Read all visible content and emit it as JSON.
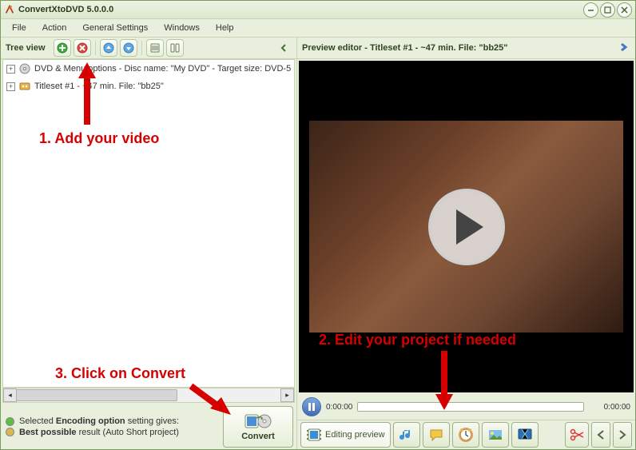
{
  "window": {
    "title": "ConvertXtoDVD 5.0.0.0"
  },
  "menu": {
    "file": "File",
    "action": "Action",
    "settings": "General Settings",
    "windows": "Windows",
    "help": "Help"
  },
  "left": {
    "header": "Tree view",
    "rows": [
      {
        "text": "DVD & Menu options - Disc name: \"My DVD\" - Target size: DVD-5"
      },
      {
        "text": "Titleset #1 - ~47 min. File: \"bb25\""
      }
    ],
    "status_html_parts": {
      "p1": "Selected ",
      "p2": "Encoding option",
      "p3": " setting gives: ",
      "p4": "Best possible",
      "p5": " result (Auto Short project)"
    },
    "convert_label": "Convert"
  },
  "right": {
    "header": "Preview editor - Titleset #1 - ~47 min. File: \"bb25\"",
    "time_start": "0:00:00",
    "time_end": "0:00:00",
    "tabs": {
      "editing": "Editing preview"
    }
  },
  "annotations": {
    "a1": "1. Add your video",
    "a2": "2. Edit your project if needed",
    "a3": "3. Click on Convert"
  }
}
